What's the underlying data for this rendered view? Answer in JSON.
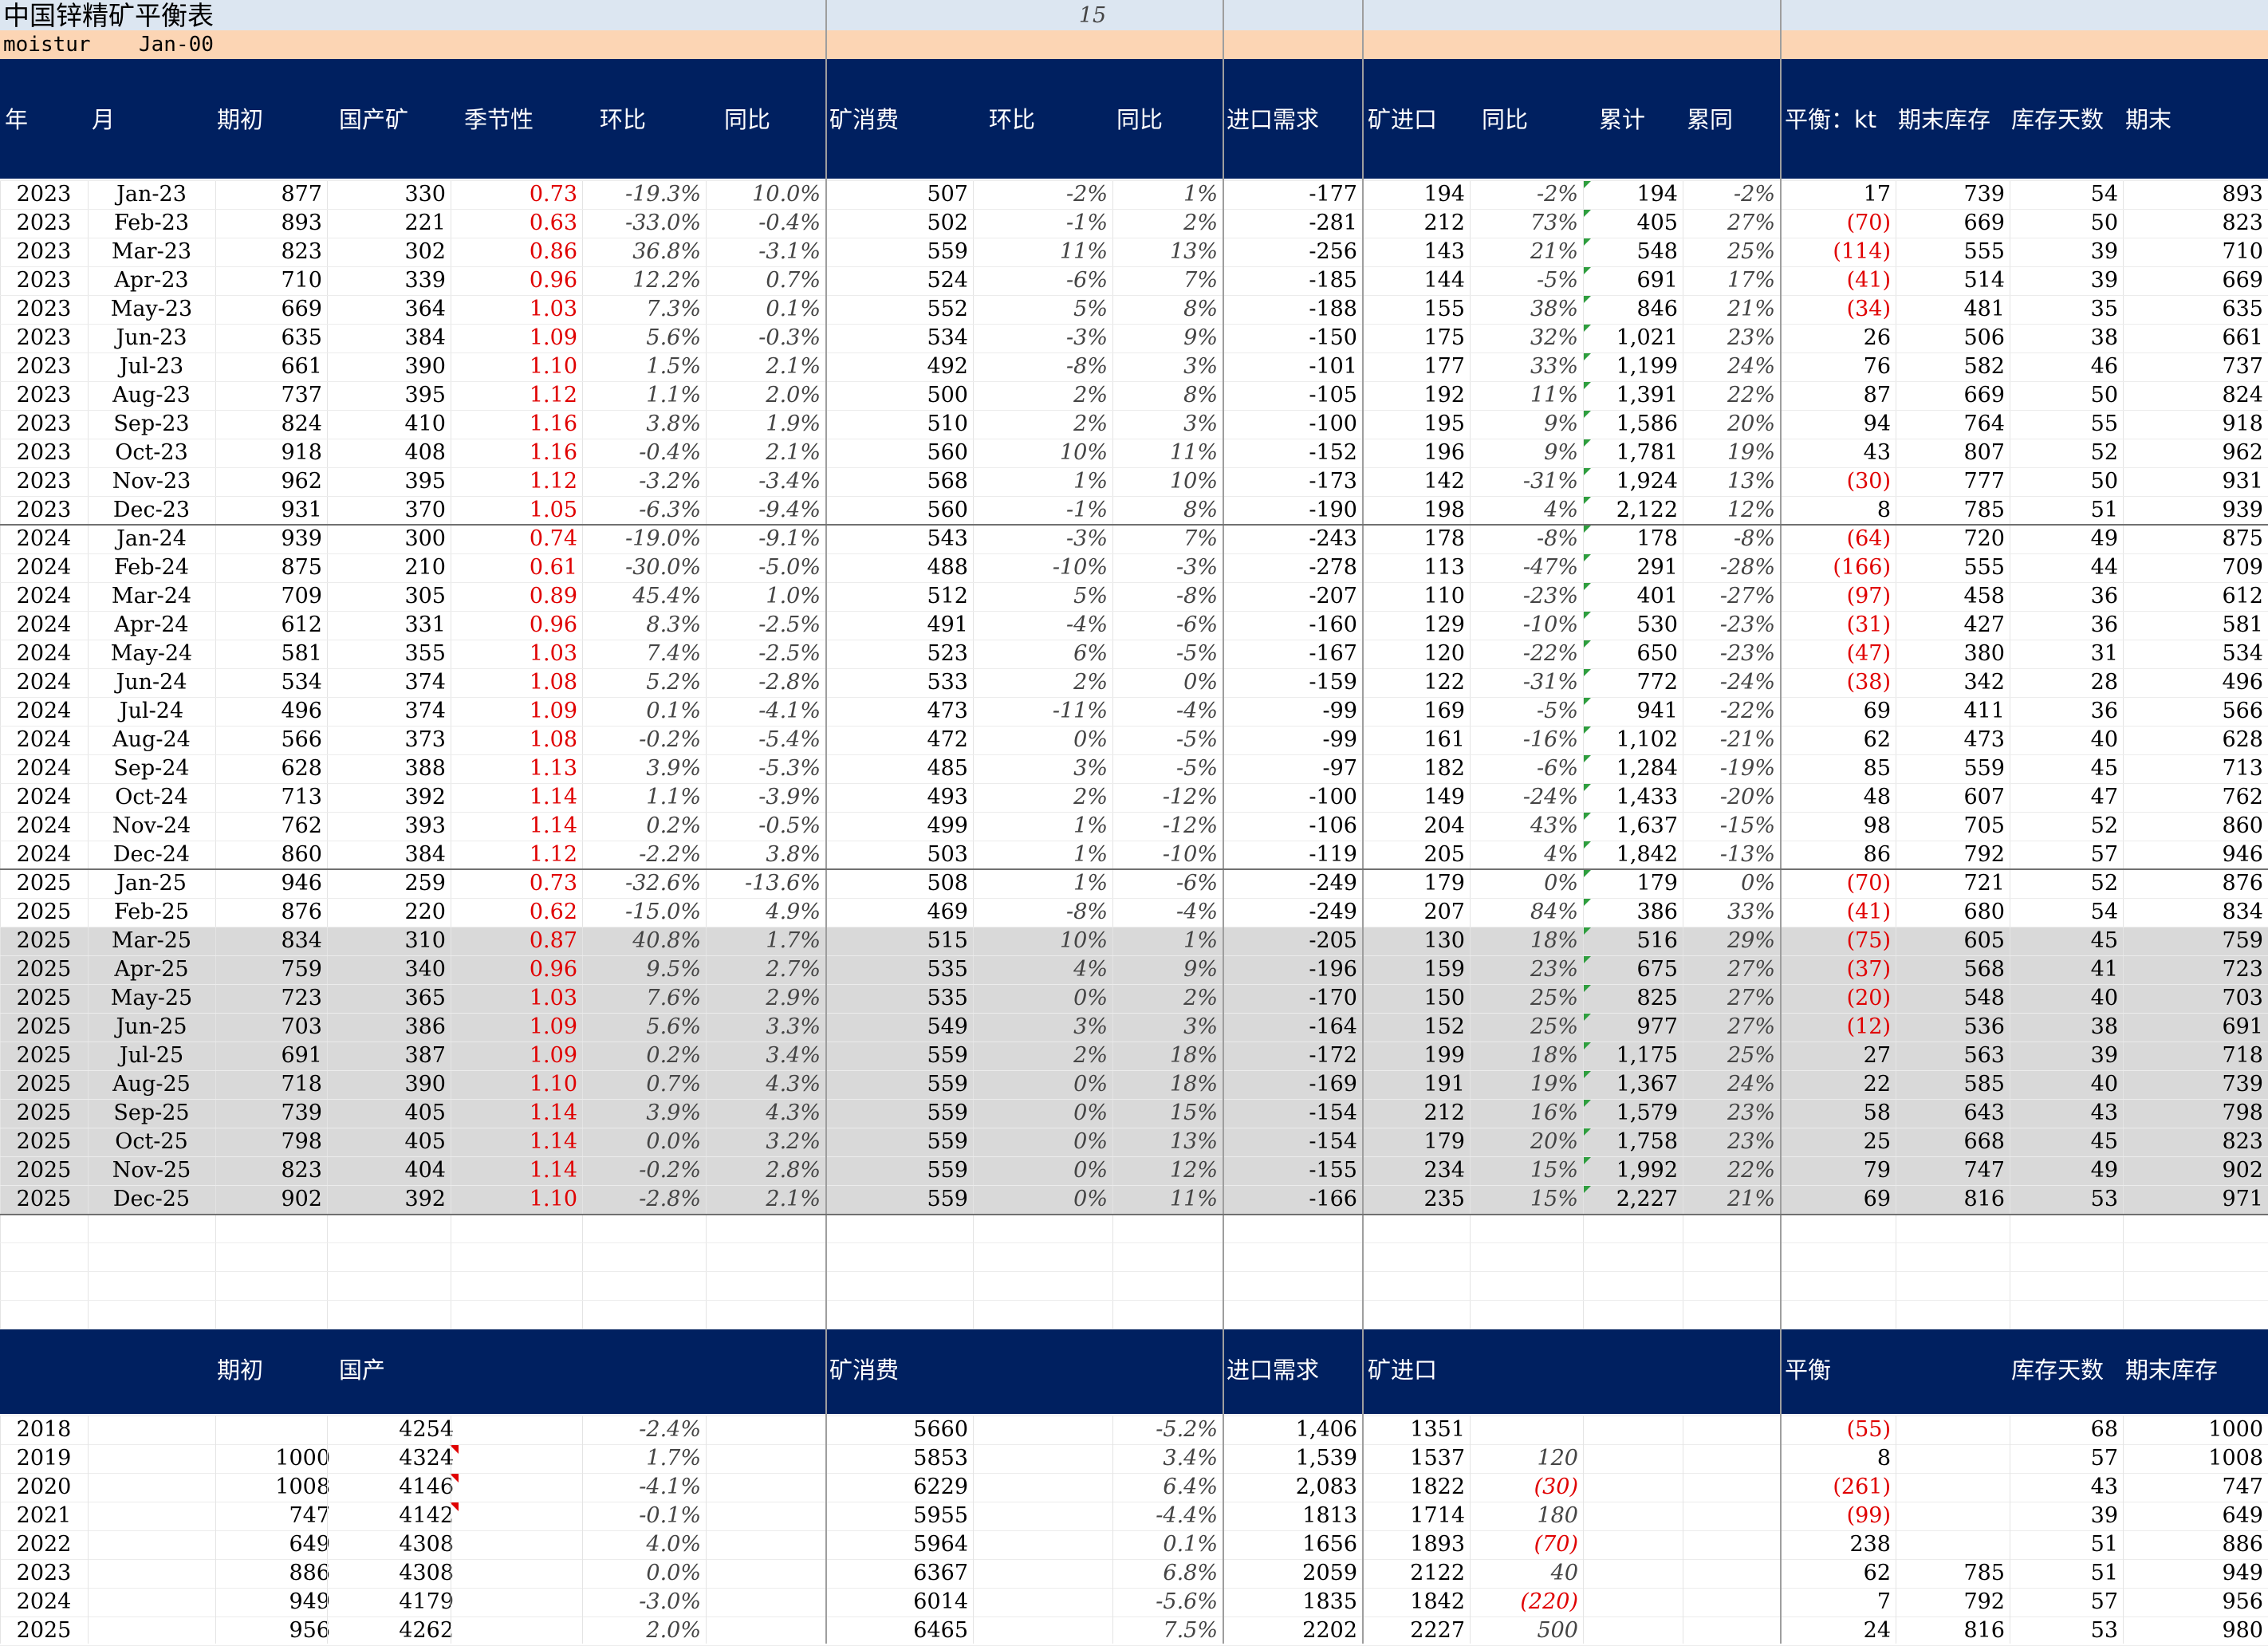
{
  "sheet": {
    "title": "中国锌精矿平衡表",
    "title_number": "15",
    "moisture_label": "moistur",
    "moisture_date": "Jan-00"
  },
  "monthly": {
    "headers": [
      "年",
      "月",
      "期初",
      "国产矿",
      "季节性",
      "环比",
      "同比",
      "矿消费",
      "环比",
      "同比",
      "进口需求",
      "矿进口",
      "同比",
      "累计",
      "累同",
      "平衡：kt",
      "期末库存",
      "库存天数",
      "期末"
    ],
    "rows": [
      [
        "2023",
        "Jan-23",
        "877",
        "330",
        "0.73",
        "-19.3%",
        "10.0%",
        "507",
        "-2%",
        "1%",
        "-177",
        "194",
        "-2%",
        "194",
        "-2%",
        "17",
        "739",
        "54",
        "893"
      ],
      [
        "2023",
        "Feb-23",
        "893",
        "221",
        "0.63",
        "-33.0%",
        "-0.4%",
        "502",
        "-1%",
        "2%",
        "-281",
        "212",
        "73%",
        "405",
        "27%",
        "(70)",
        "669",
        "50",
        "823"
      ],
      [
        "2023",
        "Mar-23",
        "823",
        "302",
        "0.86",
        "36.8%",
        "-3.1%",
        "559",
        "11%",
        "13%",
        "-256",
        "143",
        "21%",
        "548",
        "25%",
        "(114)",
        "555",
        "39",
        "710"
      ],
      [
        "2023",
        "Apr-23",
        "710",
        "339",
        "0.96",
        "12.2%",
        "0.7%",
        "524",
        "-6%",
        "7%",
        "-185",
        "144",
        "-5%",
        "691",
        "17%",
        "(41)",
        "514",
        "39",
        "669"
      ],
      [
        "2023",
        "May-23",
        "669",
        "364",
        "1.03",
        "7.3%",
        "0.1%",
        "552",
        "5%",
        "8%",
        "-188",
        "155",
        "38%",
        "846",
        "21%",
        "(34)",
        "481",
        "35",
        "635"
      ],
      [
        "2023",
        "Jun-23",
        "635",
        "384",
        "1.09",
        "5.6%",
        "-0.3%",
        "534",
        "-3%",
        "9%",
        "-150",
        "175",
        "32%",
        "1,021",
        "23%",
        "26",
        "506",
        "38",
        "661"
      ],
      [
        "2023",
        "Jul-23",
        "661",
        "390",
        "1.10",
        "1.5%",
        "2.1%",
        "492",
        "-8%",
        "3%",
        "-101",
        "177",
        "33%",
        "1,199",
        "24%",
        "76",
        "582",
        "46",
        "737"
      ],
      [
        "2023",
        "Aug-23",
        "737",
        "395",
        "1.12",
        "1.1%",
        "2.0%",
        "500",
        "2%",
        "8%",
        "-105",
        "192",
        "11%",
        "1,391",
        "22%",
        "87",
        "669",
        "50",
        "824"
      ],
      [
        "2023",
        "Sep-23",
        "824",
        "410",
        "1.16",
        "3.8%",
        "1.9%",
        "510",
        "2%",
        "3%",
        "-100",
        "195",
        "9%",
        "1,586",
        "20%",
        "94",
        "764",
        "55",
        "918"
      ],
      [
        "2023",
        "Oct-23",
        "918",
        "408",
        "1.16",
        "-0.4%",
        "2.1%",
        "560",
        "10%",
        "11%",
        "-152",
        "196",
        "9%",
        "1,781",
        "19%",
        "43",
        "807",
        "52",
        "962"
      ],
      [
        "2023",
        "Nov-23",
        "962",
        "395",
        "1.12",
        "-3.2%",
        "-3.4%",
        "568",
        "1%",
        "10%",
        "-173",
        "142",
        "-31%",
        "1,924",
        "13%",
        "(30)",
        "777",
        "50",
        "931"
      ],
      [
        "2023",
        "Dec-23",
        "931",
        "370",
        "1.05",
        "-6.3%",
        "-9.4%",
        "560",
        "-1%",
        "8%",
        "-190",
        "198",
        "4%",
        "2,122",
        "12%",
        "8",
        "785",
        "51",
        "939"
      ],
      [
        "2024",
        "Jan-24",
        "939",
        "300",
        "0.74",
        "-19.0%",
        "-9.1%",
        "543",
        "-3%",
        "7%",
        "-243",
        "178",
        "-8%",
        "178",
        "-8%",
        "(64)",
        "720",
        "49",
        "875"
      ],
      [
        "2024",
        "Feb-24",
        "875",
        "210",
        "0.61",
        "-30.0%",
        "-5.0%",
        "488",
        "-10%",
        "-3%",
        "-278",
        "113",
        "-47%",
        "291",
        "-28%",
        "(166)",
        "555",
        "44",
        "709"
      ],
      [
        "2024",
        "Mar-24",
        "709",
        "305",
        "0.89",
        "45.4%",
        "1.0%",
        "512",
        "5%",
        "-8%",
        "-207",
        "110",
        "-23%",
        "401",
        "-27%",
        "(97)",
        "458",
        "36",
        "612"
      ],
      [
        "2024",
        "Apr-24",
        "612",
        "331",
        "0.96",
        "8.3%",
        "-2.5%",
        "491",
        "-4%",
        "-6%",
        "-160",
        "129",
        "-10%",
        "530",
        "-23%",
        "(31)",
        "427",
        "36",
        "581"
      ],
      [
        "2024",
        "May-24",
        "581",
        "355",
        "1.03",
        "7.4%",
        "-2.5%",
        "523",
        "6%",
        "-5%",
        "-167",
        "120",
        "-22%",
        "650",
        "-23%",
        "(47)",
        "380",
        "31",
        "534"
      ],
      [
        "2024",
        "Jun-24",
        "534",
        "374",
        "1.08",
        "5.2%",
        "-2.8%",
        "533",
        "2%",
        "0%",
        "-159",
        "122",
        "-31%",
        "772",
        "-24%",
        "(38)",
        "342",
        "28",
        "496"
      ],
      [
        "2024",
        "Jul-24",
        "496",
        "374",
        "1.09",
        "0.1%",
        "-4.1%",
        "473",
        "-11%",
        "-4%",
        "-99",
        "169",
        "-5%",
        "941",
        "-22%",
        "69",
        "411",
        "36",
        "566"
      ],
      [
        "2024",
        "Aug-24",
        "566",
        "373",
        "1.08",
        "-0.2%",
        "-5.4%",
        "472",
        "0%",
        "-5%",
        "-99",
        "161",
        "-16%",
        "1,102",
        "-21%",
        "62",
        "473",
        "40",
        "628"
      ],
      [
        "2024",
        "Sep-24",
        "628",
        "388",
        "1.13",
        "3.9%",
        "-5.3%",
        "485",
        "3%",
        "-5%",
        "-97",
        "182",
        "-6%",
        "1,284",
        "-19%",
        "85",
        "559",
        "45",
        "713"
      ],
      [
        "2024",
        "Oct-24",
        "713",
        "392",
        "1.14",
        "1.1%",
        "-3.9%",
        "493",
        "2%",
        "-12%",
        "-100",
        "149",
        "-24%",
        "1,433",
        "-20%",
        "48",
        "607",
        "47",
        "762"
      ],
      [
        "2024",
        "Nov-24",
        "762",
        "393",
        "1.14",
        "0.2%",
        "-0.5%",
        "499",
        "1%",
        "-12%",
        "-106",
        "204",
        "43%",
        "1,637",
        "-15%",
        "98",
        "705",
        "52",
        "860"
      ],
      [
        "2024",
        "Dec-24",
        "860",
        "384",
        "1.12",
        "-2.2%",
        "3.8%",
        "503",
        "1%",
        "-10%",
        "-119",
        "205",
        "4%",
        "1,842",
        "-13%",
        "86",
        "792",
        "57",
        "946"
      ],
      [
        "2025",
        "Jan-25",
        "946",
        "259",
        "0.73",
        "-32.6%",
        "-13.6%",
        "508",
        "1%",
        "-6%",
        "-249",
        "179",
        "0%",
        "179",
        "0%",
        "(70)",
        "721",
        "52",
        "876"
      ],
      [
        "2025",
        "Feb-25",
        "876",
        "220",
        "0.62",
        "-15.0%",
        "4.9%",
        "469",
        "-8%",
        "-4%",
        "-249",
        "207",
        "84%",
        "386",
        "33%",
        "(41)",
        "680",
        "54",
        "834"
      ],
      [
        "2025",
        "Mar-25",
        "834",
        "310",
        "0.87",
        "40.8%",
        "1.7%",
        "515",
        "10%",
        "1%",
        "-205",
        "130",
        "18%",
        "516",
        "29%",
        "(75)",
        "605",
        "45",
        "759"
      ],
      [
        "2025",
        "Apr-25",
        "759",
        "340",
        "0.96",
        "9.5%",
        "2.7%",
        "535",
        "4%",
        "9%",
        "-196",
        "159",
        "23%",
        "675",
        "27%",
        "(37)",
        "568",
        "41",
        "723"
      ],
      [
        "2025",
        "May-25",
        "723",
        "365",
        "1.03",
        "7.6%",
        "2.9%",
        "535",
        "0%",
        "2%",
        "-170",
        "150",
        "25%",
        "825",
        "27%",
        "(20)",
        "548",
        "40",
        "703"
      ],
      [
        "2025",
        "Jun-25",
        "703",
        "386",
        "1.09",
        "5.6%",
        "3.3%",
        "549",
        "3%",
        "3%",
        "-164",
        "152",
        "25%",
        "977",
        "27%",
        "(12)",
        "536",
        "38",
        "691"
      ],
      [
        "2025",
        "Jul-25",
        "691",
        "387",
        "1.09",
        "0.2%",
        "3.4%",
        "559",
        "2%",
        "18%",
        "-172",
        "199",
        "18%",
        "1,175",
        "25%",
        "27",
        "563",
        "39",
        "718"
      ],
      [
        "2025",
        "Aug-25",
        "718",
        "390",
        "1.10",
        "0.7%",
        "4.3%",
        "559",
        "0%",
        "18%",
        "-169",
        "191",
        "19%",
        "1,367",
        "24%",
        "22",
        "585",
        "40",
        "739"
      ],
      [
        "2025",
        "Sep-25",
        "739",
        "405",
        "1.14",
        "3.9%",
        "4.3%",
        "559",
        "0%",
        "15%",
        "-154",
        "212",
        "16%",
        "1,579",
        "23%",
        "58",
        "643",
        "43",
        "798"
      ],
      [
        "2025",
        "Oct-25",
        "798",
        "405",
        "1.14",
        "0.0%",
        "3.2%",
        "559",
        "0%",
        "13%",
        "-154",
        "179",
        "20%",
        "1,758",
        "23%",
        "25",
        "668",
        "45",
        "823"
      ],
      [
        "2025",
        "Nov-25",
        "823",
        "404",
        "1.14",
        "-0.2%",
        "2.8%",
        "559",
        "0%",
        "12%",
        "-155",
        "234",
        "15%",
        "1,992",
        "22%",
        "79",
        "747",
        "49",
        "902"
      ],
      [
        "2025",
        "Dec-25",
        "902",
        "392",
        "1.10",
        "-2.8%",
        "2.1%",
        "559",
        "0%",
        "11%",
        "-166",
        "235",
        "15%",
        "2,227",
        "21%",
        "69",
        "816",
        "53",
        "971"
      ]
    ]
  },
  "annual": {
    "headers": [
      "期初",
      "国产",
      "矿消费",
      "进口需求",
      "矿进口",
      "平衡",
      "库存天数",
      "期末库存"
    ],
    "rows": [
      [
        "2018",
        "",
        "4254",
        "-2.4%",
        "5660",
        "-5.2%",
        "1,406",
        "1351",
        "",
        "(55)",
        "",
        "68",
        "1000"
      ],
      [
        "2019",
        "1000",
        "4324",
        "1.7%",
        "5853",
        "3.4%",
        "1,539",
        "1537",
        "120",
        "8",
        "",
        "57",
        "1008"
      ],
      [
        "2020",
        "1008",
        "4146",
        "-4.1%",
        "6229",
        "6.4%",
        "2,083",
        "1822",
        "(30)",
        "(261)",
        "",
        "43",
        "747"
      ],
      [
        "2021",
        "747",
        "4142",
        "-0.1%",
        "5955",
        "-4.4%",
        "1813",
        "1714",
        "180",
        "(99)",
        "",
        "39",
        "649"
      ],
      [
        "2022",
        "649",
        "4308",
        "4.0%",
        "5964",
        "0.1%",
        "1656",
        "1893",
        "(70)",
        "238",
        "",
        "51",
        "886"
      ],
      [
        "2023",
        "886",
        "4308",
        "0.0%",
        "6367",
        "6.8%",
        "2059",
        "2122",
        "40",
        "62",
        "785",
        "51",
        "949"
      ],
      [
        "2024",
        "949",
        "4179",
        "-3.0%",
        "6014",
        "-5.6%",
        "1835",
        "1842",
        "(220)",
        "7",
        "792",
        "57",
        "956"
      ],
      [
        "2025",
        "956",
        "4262",
        "2.0%",
        "6465",
        "7.5%",
        "2202",
        "2227",
        "500",
        "24",
        "816",
        "53",
        "980"
      ]
    ]
  },
  "colors": {
    "header_bg": "#002060",
    "title_bg": "#dce6f1",
    "moisture_bg": "#fcd5b4",
    "forecast_bg": "#d9d9d9",
    "negative_red": "#e00000",
    "flag_green": "#2e9e3e",
    "flag_red": "#e00000"
  }
}
